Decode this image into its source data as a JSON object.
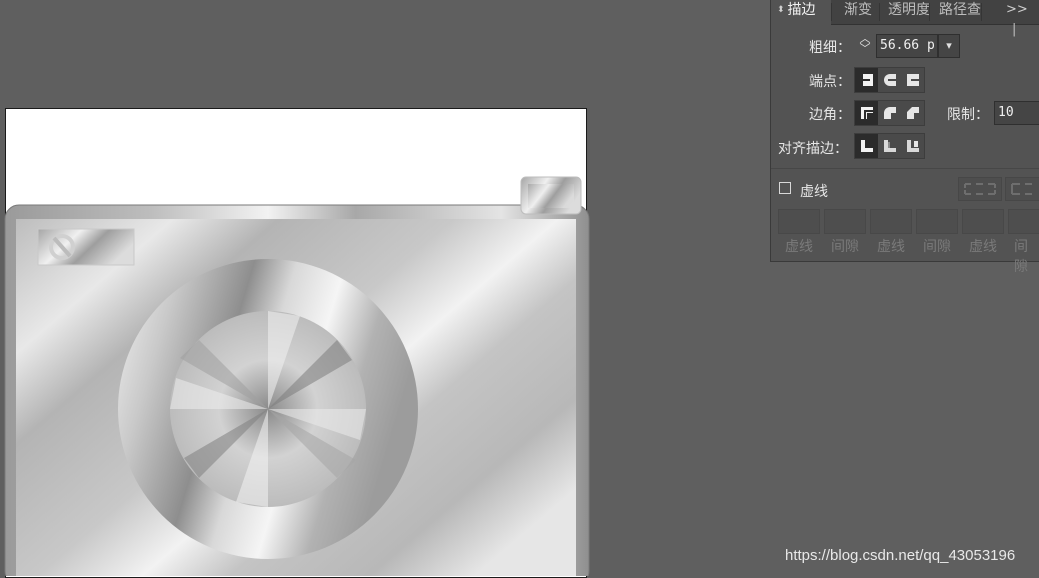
{
  "panel": {
    "tabs": [
      {
        "label": "描边",
        "active": true
      },
      {
        "label": "渐变",
        "active": false
      },
      {
        "label": "透明度",
        "active": false
      },
      {
        "label": "路径查",
        "active": false
      }
    ],
    "collapse_label": ">>",
    "weight_label": "粗细：",
    "weight_value": "56.66 p",
    "cap_label": "端点：",
    "corner_label": "边角：",
    "limit_label": "限制：",
    "limit_value": "10",
    "align_label": "对齐描边：",
    "dashed_label": "虚线",
    "dashed_checked": false,
    "dash_slots": [
      "虚线",
      "间隙",
      "虚线",
      "间隙",
      "虚线",
      "间隙"
    ]
  },
  "watermark": "https://blog.csdn.net/qq_43053196",
  "colors": {
    "workspace": "#5f5f5f",
    "panel_bg": "#535353",
    "tab_bar": "#424242",
    "selected_button": "#2b2b2b"
  }
}
